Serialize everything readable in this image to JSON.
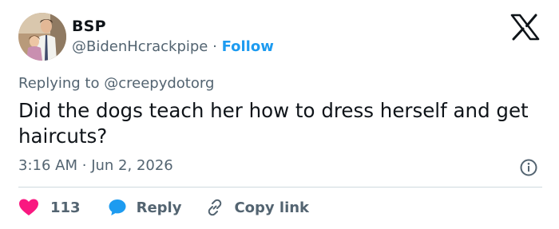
{
  "author": {
    "name": "BSP",
    "handle": "@BidenHcrackpipe",
    "separator": "·",
    "follow_label": "Follow"
  },
  "reply_context": {
    "prefix": "Replying to",
    "target": "@creepydotorg"
  },
  "tweet": {
    "text": "Did the dogs teach her how to dress herself and get haircuts?",
    "time": "3:16 AM",
    "separator": "·",
    "date": "Jun 2, 2026"
  },
  "actions": {
    "like_count": "113",
    "reply_label": "Reply",
    "copy_label": "Copy link"
  },
  "icons": {
    "brand": "x-logo-icon",
    "info": "info-icon",
    "like": "heart-icon",
    "reply": "speech-bubble-icon",
    "copy": "link-icon"
  },
  "colors": {
    "text": "#0f1419",
    "secondary": "#536471",
    "accent": "#1d9bf0",
    "like": "#f91880",
    "divider": "#cfd9de"
  }
}
